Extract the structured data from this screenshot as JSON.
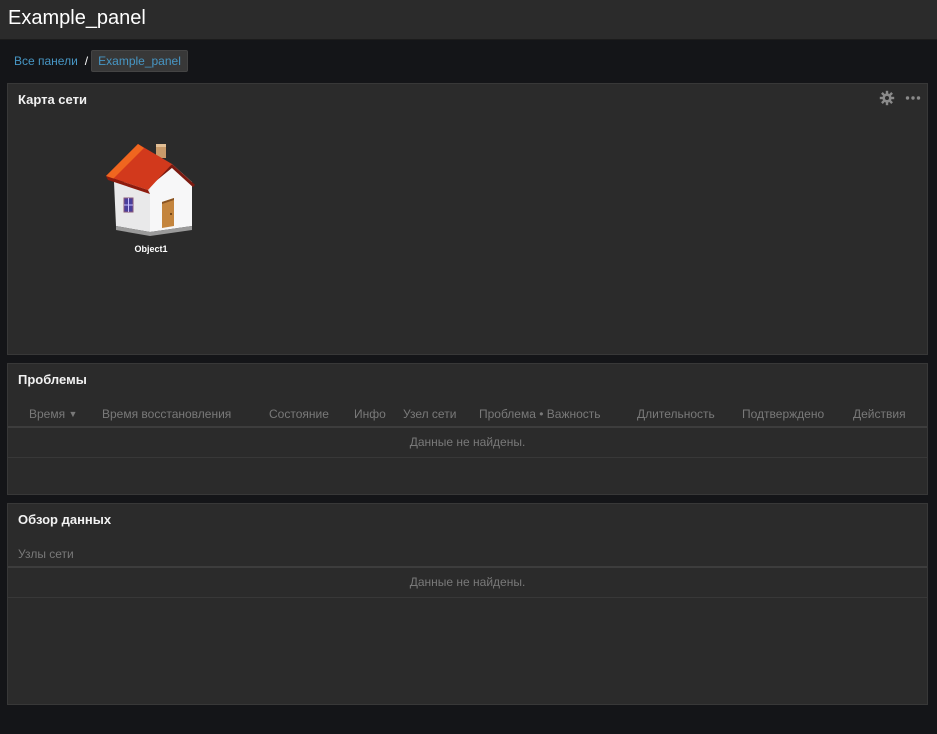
{
  "header": {
    "title": "Example_panel"
  },
  "breadcrumb": {
    "items": [
      "Все панели",
      "Example_panel"
    ],
    "separator": "/"
  },
  "map_widget": {
    "title": "Карта сети",
    "object_label": "Object1"
  },
  "problems_widget": {
    "title": "Проблемы",
    "columns": {
      "time": "Время",
      "recovery_time": "Время восстановления",
      "status": "Состояние",
      "info": "Инфо",
      "host": "Узел сети",
      "problem_severity": "Проблема • Важность",
      "duration": "Длительность",
      "ack": "Подтверждено",
      "actions": "Действия"
    },
    "empty_text": "Данные не найдены."
  },
  "overview_widget": {
    "title": "Обзор данных",
    "columns": {
      "hosts": "Узлы сети"
    },
    "empty_text": "Данные не найдены."
  },
  "colors": {
    "link": "#4796c4",
    "panel_bg": "#2b2b2b",
    "page_bg": "#141518",
    "muted_text": "#797979"
  }
}
